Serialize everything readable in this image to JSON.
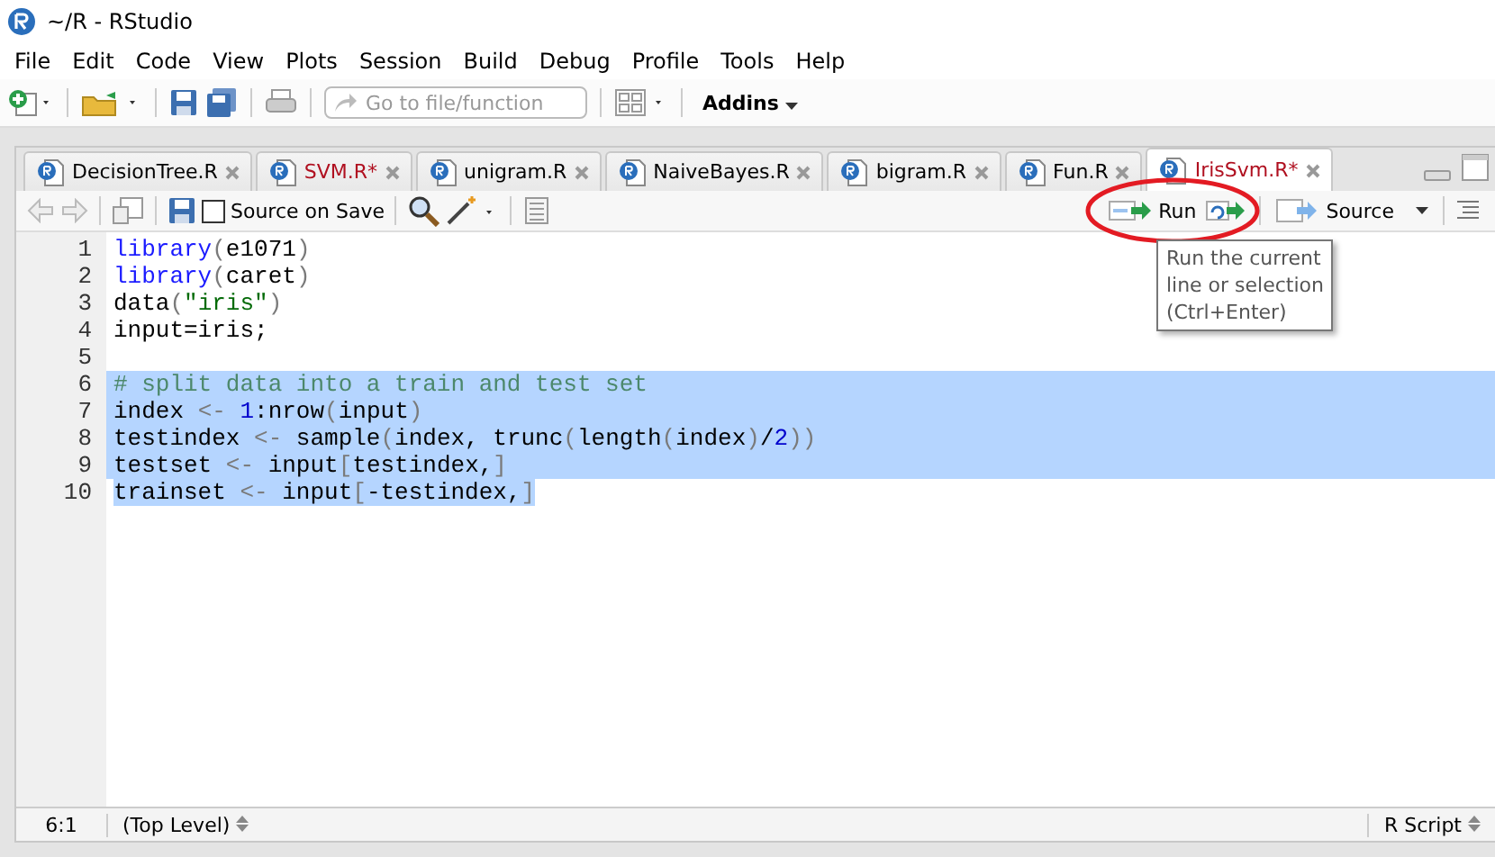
{
  "window": {
    "title": "~/R - RStudio"
  },
  "menu": [
    "File",
    "Edit",
    "Code",
    "View",
    "Plots",
    "Session",
    "Build",
    "Debug",
    "Profile",
    "Tools",
    "Help"
  ],
  "toolbar": {
    "goto_placeholder": "Go to file/function",
    "addins": "Addins"
  },
  "tabs": [
    {
      "label": "DecisionTree.R",
      "modified": false,
      "selected": false
    },
    {
      "label": "SVM.R*",
      "modified": true,
      "selected": false
    },
    {
      "label": "unigram.R",
      "modified": false,
      "selected": false
    },
    {
      "label": "NaiveBayes.R",
      "modified": false,
      "selected": false
    },
    {
      "label": "bigram.R",
      "modified": false,
      "selected": false
    },
    {
      "label": "Fun.R",
      "modified": false,
      "selected": false
    },
    {
      "label": "IrisSvm.R*",
      "modified": true,
      "selected": true
    }
  ],
  "editor_toolbar": {
    "source_on_save": {
      "label": "Source on Save",
      "checked": false
    },
    "run": "Run",
    "source": "Source"
  },
  "tooltip": {
    "lines": [
      "Run the current",
      "line or selection",
      "(Ctrl+Enter)"
    ]
  },
  "code_lines": [
    {
      "number": "1",
      "selected": false,
      "tokens": [
        {
          "kind": "fn",
          "text": "library"
        },
        {
          "kind": "punct",
          "text": "("
        },
        {
          "kind": "plain",
          "text": "e1071"
        },
        {
          "kind": "punct",
          "text": ")"
        }
      ]
    },
    {
      "number": "2",
      "selected": false,
      "tokens": [
        {
          "kind": "fn",
          "text": "library"
        },
        {
          "kind": "punct",
          "text": "("
        },
        {
          "kind": "plain",
          "text": "caret"
        },
        {
          "kind": "punct",
          "text": ")"
        }
      ]
    },
    {
      "number": "3",
      "selected": false,
      "tokens": [
        {
          "kind": "plain",
          "text": "data"
        },
        {
          "kind": "punct",
          "text": "("
        },
        {
          "kind": "str",
          "text": "\"iris\""
        },
        {
          "kind": "punct",
          "text": ")"
        }
      ]
    },
    {
      "number": "4",
      "selected": false,
      "tokens": [
        {
          "kind": "plain",
          "text": "input=iris;"
        }
      ]
    },
    {
      "number": "5",
      "selected": false
    },
    {
      "number": "6",
      "selected": true,
      "tokens": [
        {
          "kind": "comment",
          "text": "# split data into a train and test set"
        }
      ]
    },
    {
      "number": "7",
      "selected": true,
      "tokens": [
        {
          "kind": "plain",
          "text": "index "
        },
        {
          "kind": "punct",
          "text": "<-"
        },
        {
          "kind": "num",
          "text": " 1"
        },
        {
          "kind": "plain",
          "text": ":nrow"
        },
        {
          "kind": "punct",
          "text": "("
        },
        {
          "kind": "plain",
          "text": "input"
        },
        {
          "kind": "punct",
          "text": ")"
        }
      ]
    },
    {
      "number": "8",
      "selected": true,
      "tokens": [
        {
          "kind": "plain",
          "text": "testindex "
        },
        {
          "kind": "punct",
          "text": "<-"
        },
        {
          "kind": "plain",
          "text": " sample"
        },
        {
          "kind": "punct",
          "text": "("
        },
        {
          "kind": "plain",
          "text": "index, trunc"
        },
        {
          "kind": "punct",
          "text": "("
        },
        {
          "kind": "plain",
          "text": "length"
        },
        {
          "kind": "punct",
          "text": "("
        },
        {
          "kind": "plain",
          "text": "index"
        },
        {
          "kind": "punct",
          "text": ")"
        },
        {
          "kind": "plain",
          "text": "/"
        },
        {
          "kind": "num",
          "text": "2"
        },
        {
          "kind": "punct",
          "text": "))"
        }
      ]
    },
    {
      "number": "9",
      "selected": true,
      "tokens": [
        {
          "kind": "plain",
          "text": "testset "
        },
        {
          "kind": "punct",
          "text": "<-"
        },
        {
          "kind": "plain",
          "text": " input"
        },
        {
          "kind": "punct",
          "text": "["
        },
        {
          "kind": "plain",
          "text": "testindex,"
        },
        {
          "kind": "punct",
          "text": "]"
        }
      ]
    },
    {
      "number": "10",
      "selected": true,
      "tokens": [
        {
          "kind": "plain",
          "text": "trainset "
        },
        {
          "kind": "punct",
          "text": "<-"
        },
        {
          "kind": "plain",
          "text": " input"
        },
        {
          "kind": "punct",
          "text": "["
        },
        {
          "kind": "plain",
          "text": "-testindex,"
        },
        {
          "kind": "punct",
          "text": "]"
        }
      ]
    }
  ],
  "status_bar": {
    "position": "6:1",
    "scope": "(Top Level)",
    "file_type": "R Script"
  }
}
